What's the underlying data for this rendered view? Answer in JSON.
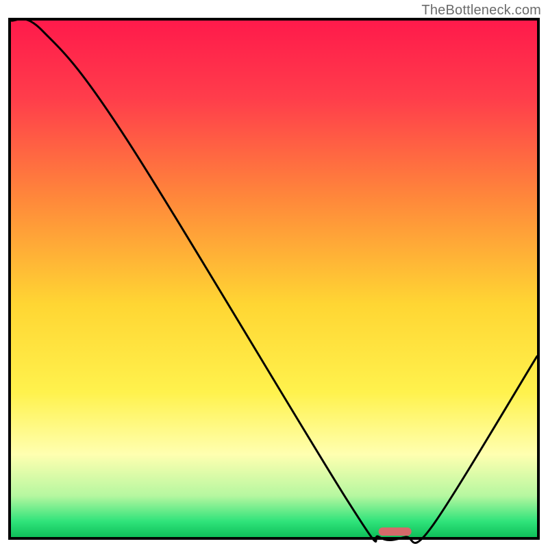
{
  "watermark": "TheBottleneck.com",
  "chart_data": {
    "type": "line",
    "title": "",
    "xlabel": "",
    "ylabel": "",
    "xlim": [
      0,
      100
    ],
    "ylim": [
      0,
      100
    ],
    "x": [
      0,
      6,
      22,
      64,
      70,
      75,
      80,
      100
    ],
    "values": [
      100,
      98,
      77,
      7,
      0,
      0,
      2,
      35
    ],
    "optimum_marker_x": 73,
    "background": {
      "type": "vertical_gradient",
      "stops": [
        {
          "offset": 0.0,
          "color": "#ff1a4b"
        },
        {
          "offset": 0.15,
          "color": "#ff3d4b"
        },
        {
          "offset": 0.35,
          "color": "#ff8a3a"
        },
        {
          "offset": 0.55,
          "color": "#ffd633"
        },
        {
          "offset": 0.72,
          "color": "#fff24d"
        },
        {
          "offset": 0.84,
          "color": "#ffffb0"
        },
        {
          "offset": 0.92,
          "color": "#b6f7a0"
        },
        {
          "offset": 0.97,
          "color": "#2fe37a"
        },
        {
          "offset": 1.0,
          "color": "#0fbf5a"
        }
      ]
    },
    "marker": {
      "color": "#d46a6a",
      "width": 48,
      "height": 12,
      "y_offset": 0
    },
    "border_color": "#000000"
  }
}
